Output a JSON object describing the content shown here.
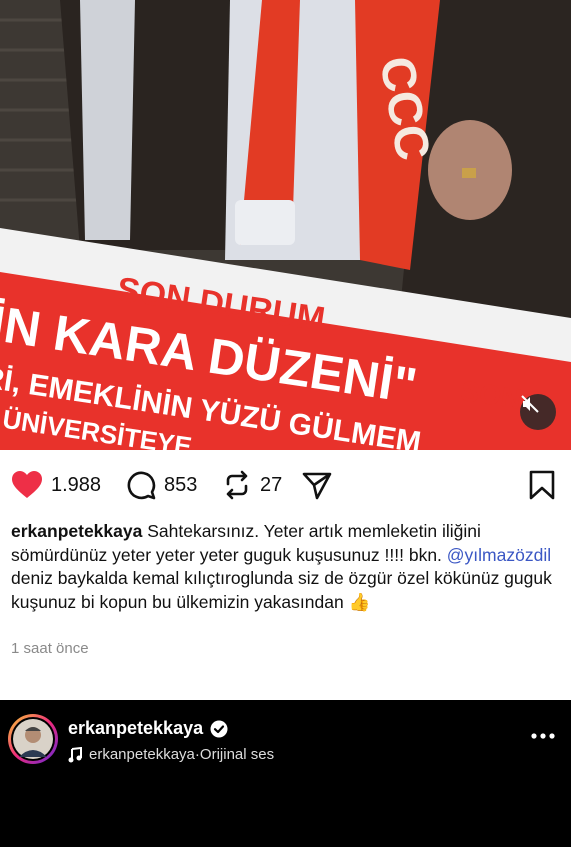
{
  "media": {
    "banner_top": "SON DURUM",
    "banner_main": "İN KARA DÜZENİ\"",
    "banner_sub": "Rİ, EMEKLİNİN YÜZÜ GÜLMEM",
    "banner_bottom": "N ÜNİVERSİTEYE",
    "banner_right": "SON D",
    "colors": {
      "banner_red": "#e8322b",
      "scarf_red": "#e23b24"
    }
  },
  "actions": {
    "likes": "1.988",
    "comments": "853",
    "reposts": "27"
  },
  "caption": {
    "username": "erkanpetekkaya",
    "text_1": " Sahtekarsınız. Yeter artık memleketin iliğini sömürdünüz yeter yeter yeter  guguk kuşusunuz !!!! bkn. ",
    "mention": "@yılmazözdil",
    "text_2": " deniz baykalda kemal kılıçtıroglunda siz de özgür özel kökünüz guguk kuşunuz  bi kopun bu ülkemizin yakasından ",
    "emoji": "👍"
  },
  "timestamp": "1 saat önce",
  "bottom_bar": {
    "username": "erkanpetekkaya",
    "audio_owner": "erkanpetekkaya",
    "audio_sep": " · ",
    "audio_label": "Orijinal ses"
  },
  "icons": [
    "heart-icon",
    "comment-icon",
    "repost-icon",
    "share-icon",
    "bookmark-icon",
    "mute-icon",
    "verified-icon",
    "music-note-icon",
    "more-icon"
  ]
}
